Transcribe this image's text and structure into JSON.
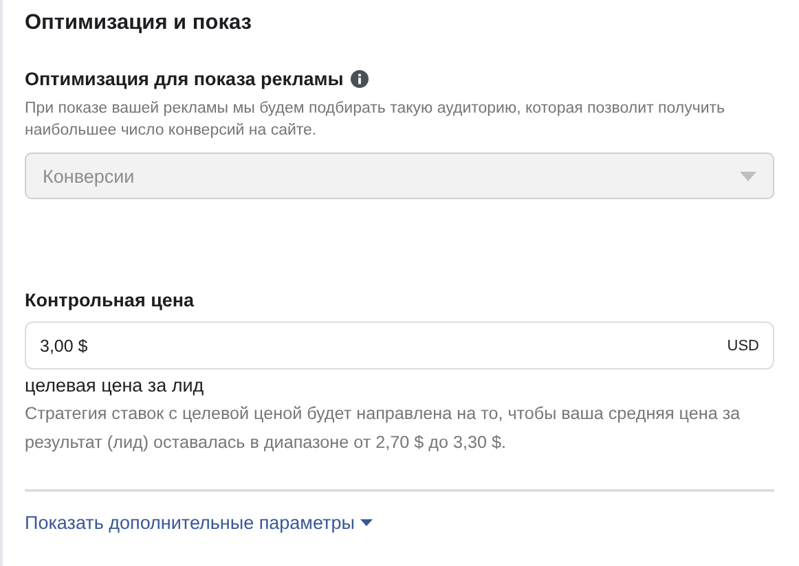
{
  "section": {
    "title": "Оптимизация и показ"
  },
  "optimization": {
    "label": "Оптимизация для показа рекламы",
    "description": "При показе вашей рекламы мы будем подбирать такую аудиторию, которая позволит получить наибольшее число конверсий на сайте.",
    "select": {
      "value": "Конверсии",
      "disabled": true
    }
  },
  "bid_cap": {
    "label": "Контрольная цена",
    "value": "3,00 $",
    "currency": "USD",
    "sublabel": "целевая цена за лид",
    "help": "Стратегия ставок с целевой ценой будет направлена на то, чтобы ваша средняя цена за результат (лид) оставалась в диапазоне от 2,70 $ до 3,30 $."
  },
  "more_link": {
    "label": "Показать дополнительные параметры"
  }
}
